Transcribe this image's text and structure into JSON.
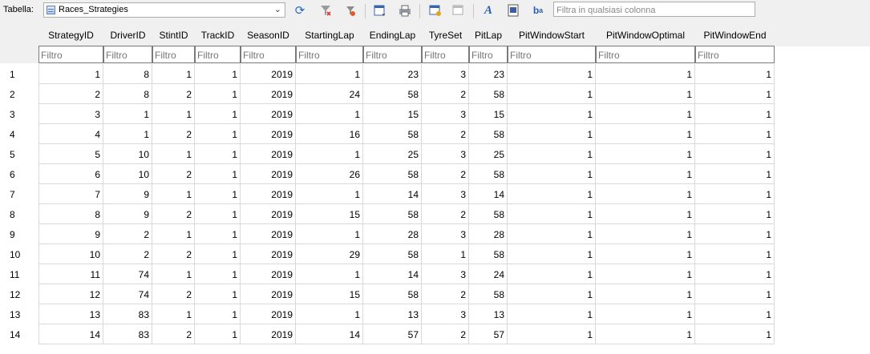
{
  "toolbar": {
    "table_label": "Tabella:",
    "table_name": "Races_Strategies",
    "filter_placeholder": "Filtra in qualsiasi colonna",
    "icons": [
      "refresh-icon",
      "clear-filters-icon",
      "save-filters-icon",
      "export-icon",
      "print-icon",
      "new-record-icon",
      "delete-record-icon",
      "find-replace-icon",
      "encoding-icon",
      "hide-columns-icon"
    ]
  },
  "columns": [
    "StrategyID",
    "DriverID",
    "StintID",
    "TrackID",
    "SeasonID",
    "StartingLap",
    "EndingLap",
    "TyreSet",
    "PitLap",
    "PitWindowStart",
    "PitWindowOptimal",
    "PitWindowEnd"
  ],
  "filter_placeholder": "Filtro",
  "rows": [
    {
      "n": "1",
      "v": [
        "1",
        "8",
        "1",
        "1",
        "2019",
        "1",
        "23",
        "3",
        "23",
        "1",
        "1",
        "1"
      ]
    },
    {
      "n": "2",
      "v": [
        "2",
        "8",
        "2",
        "1",
        "2019",
        "24",
        "58",
        "2",
        "58",
        "1",
        "1",
        "1"
      ]
    },
    {
      "n": "3",
      "v": [
        "3",
        "1",
        "1",
        "1",
        "2019",
        "1",
        "15",
        "3",
        "15",
        "1",
        "1",
        "1"
      ]
    },
    {
      "n": "4",
      "v": [
        "4",
        "1",
        "2",
        "1",
        "2019",
        "16",
        "58",
        "2",
        "58",
        "1",
        "1",
        "1"
      ]
    },
    {
      "n": "5",
      "v": [
        "5",
        "10",
        "1",
        "1",
        "2019",
        "1",
        "25",
        "3",
        "25",
        "1",
        "1",
        "1"
      ]
    },
    {
      "n": "6",
      "v": [
        "6",
        "10",
        "2",
        "1",
        "2019",
        "26",
        "58",
        "2",
        "58",
        "1",
        "1",
        "1"
      ]
    },
    {
      "n": "7",
      "v": [
        "7",
        "9",
        "1",
        "1",
        "2019",
        "1",
        "14",
        "3",
        "14",
        "1",
        "1",
        "1"
      ]
    },
    {
      "n": "8",
      "v": [
        "8",
        "9",
        "2",
        "1",
        "2019",
        "15",
        "58",
        "2",
        "58",
        "1",
        "1",
        "1"
      ]
    },
    {
      "n": "9",
      "v": [
        "9",
        "2",
        "1",
        "1",
        "2019",
        "1",
        "28",
        "3",
        "28",
        "1",
        "1",
        "1"
      ]
    },
    {
      "n": "10",
      "v": [
        "10",
        "2",
        "2",
        "1",
        "2019",
        "29",
        "58",
        "1",
        "58",
        "1",
        "1",
        "1"
      ]
    },
    {
      "n": "11",
      "v": [
        "11",
        "74",
        "1",
        "1",
        "2019",
        "1",
        "14",
        "3",
        "24",
        "1",
        "1",
        "1"
      ]
    },
    {
      "n": "12",
      "v": [
        "12",
        "74",
        "2",
        "1",
        "2019",
        "15",
        "58",
        "2",
        "58",
        "1",
        "1",
        "1"
      ]
    },
    {
      "n": "13",
      "v": [
        "13",
        "83",
        "1",
        "1",
        "2019",
        "1",
        "13",
        "3",
        "13",
        "1",
        "1",
        "1"
      ]
    },
    {
      "n": "14",
      "v": [
        "14",
        "83",
        "2",
        "1",
        "2019",
        "14",
        "57",
        "2",
        "57",
        "1",
        "1",
        "1"
      ]
    }
  ]
}
